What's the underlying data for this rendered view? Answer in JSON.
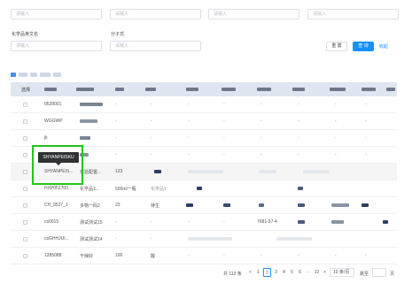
{
  "filters": {
    "placeholder": "请输入",
    "label_cn_en": "化学品英文名",
    "label_formula": "分子式"
  },
  "buttons": {
    "reset": "重 置",
    "search": "查 询",
    "collapse": "收起"
  },
  "table": {
    "header_select": "选择",
    "rows": [
      {
        "c1": "0528001",
        "c2": "",
        "c3": "-",
        "c4": "-"
      },
      {
        "c1": "WGGWP",
        "c2": "",
        "c3": "-",
        "c4": "-"
      },
      {
        "c1": "jk",
        "c2": "",
        "c3": "-",
        "c4": "-"
      },
      {
        "c1": "",
        "c2": "",
        "c3": "-",
        "c4": "-"
      },
      {
        "c1": "SHYANPEIS...",
        "c2": "实验配置...",
        "c3": "123",
        "c4": ""
      },
      {
        "c1": "HXP052700...",
        "c2": "化学品1...",
        "c3": "500ml一瓶",
        "c4": "化学品1"
      },
      {
        "c1": "CH_0527_1",
        "c2": "多物一码2",
        "c3": "23",
        "c4": "待生"
      },
      {
        "c1": "cs0015",
        "c2": "测试测试15",
        "c3": "-",
        "c4": "-",
        "c6": "7681-57-4"
      },
      {
        "c1": "csGHHJUI...",
        "c2": "测试测试14",
        "c3": "-",
        "c4": "-"
      },
      {
        "c1": "1285088",
        "c2": "干燥好",
        "c3": "100",
        "c4": "酸"
      }
    ]
  },
  "tooltip": "SHYANPEISKU",
  "pagination": {
    "total": "共 113 条",
    "prev": "<",
    "pages": [
      "1",
      "2",
      "3",
      "4",
      "5",
      "6",
      "···",
      "12"
    ],
    "next": ">",
    "page_size": "10 条/页",
    "jump_label": "跳至",
    "page_unit": "页"
  },
  "colors": {
    "primary": "#1890ff",
    "highlight_box": "#22c51b",
    "tooltip_bg": "#303133"
  }
}
